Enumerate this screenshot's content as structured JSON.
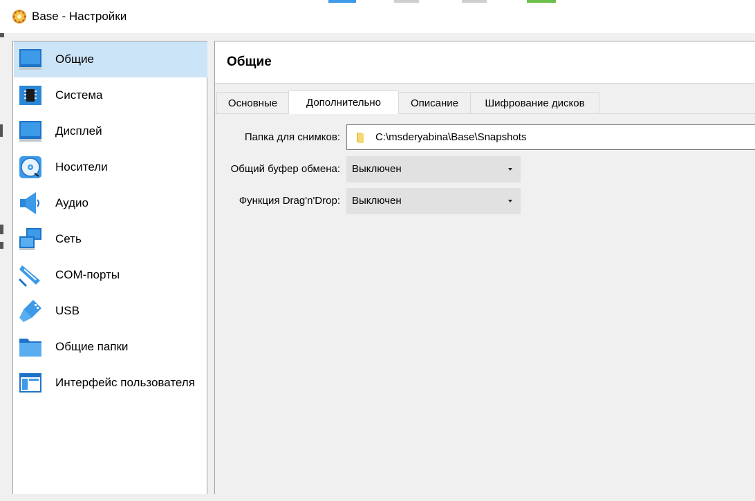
{
  "window": {
    "title": "Base - Настройки"
  },
  "sidebar": {
    "items": [
      {
        "label": "Общие",
        "icon": "monitor-icon",
        "selected": true
      },
      {
        "label": "Система",
        "icon": "chip-icon",
        "selected": false
      },
      {
        "label": "Дисплей",
        "icon": "display-icon",
        "selected": false
      },
      {
        "label": "Носители",
        "icon": "disc-icon",
        "selected": false
      },
      {
        "label": "Аудио",
        "icon": "speaker-icon",
        "selected": false
      },
      {
        "label": "Сеть",
        "icon": "network-icon",
        "selected": false
      },
      {
        "label": "COM-порты",
        "icon": "serial-port-icon",
        "selected": false
      },
      {
        "label": "USB",
        "icon": "usb-icon",
        "selected": false
      },
      {
        "label": "Общие папки",
        "icon": "folder-icon",
        "selected": false
      },
      {
        "label": "Интерфейс пользователя",
        "icon": "ui-window-icon",
        "selected": false
      }
    ]
  },
  "content": {
    "title": "Общие",
    "tabs": [
      {
        "label": "Основные",
        "active": false
      },
      {
        "label": "Дополнительно",
        "active": true
      },
      {
        "label": "Описание",
        "active": false
      },
      {
        "label": "Шифрование дисков",
        "active": false
      }
    ],
    "fields": {
      "snapshots_label": "Папка для снимков:",
      "snapshots_value": "C:\\msderyabina\\Base\\Snapshots",
      "clipboard_label": "Общий буфер обмена:",
      "clipboard_value": "Выключен",
      "dragdrop_label": "Функция Drag'n'Drop:",
      "dragdrop_value": "Выключен"
    }
  },
  "colors": {
    "selected_bg": "#cce4f7",
    "icon_blue": "#3c9ae8",
    "combo_bg": "#e1e1e1"
  }
}
